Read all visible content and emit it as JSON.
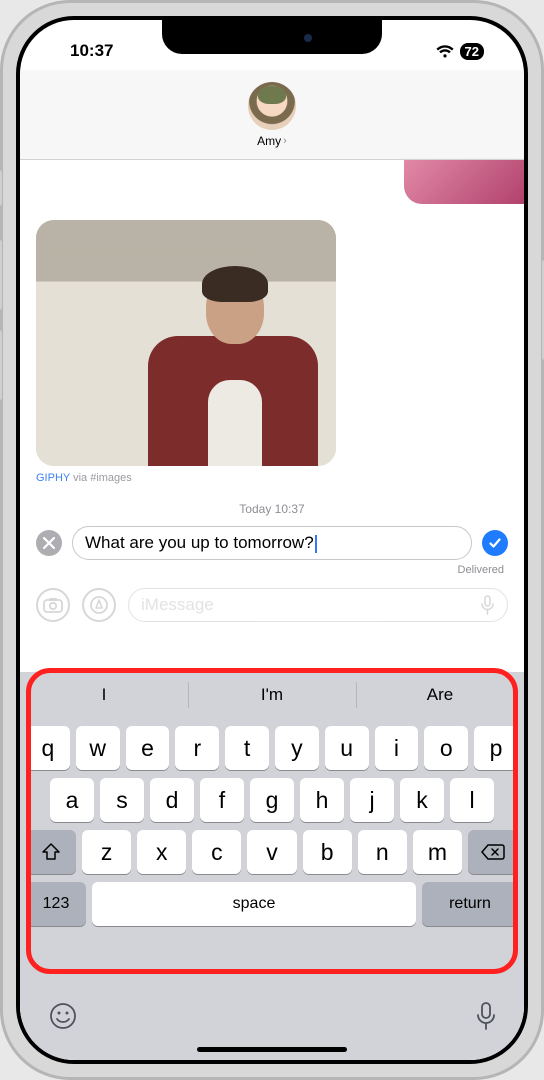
{
  "status": {
    "time": "10:37",
    "battery": "72"
  },
  "contact": {
    "name": "Amy"
  },
  "gif": {
    "source": "GIPHY",
    "via": " via #images"
  },
  "timestamp": "Today 10:37",
  "edit": {
    "text": "What are you up to tomorrow?"
  },
  "delivered": "Delivered",
  "compose": {
    "placeholder": "iMessage"
  },
  "suggestions": [
    "I",
    "I'm",
    "Are"
  ],
  "keys": {
    "row1": [
      "q",
      "w",
      "e",
      "r",
      "t",
      "y",
      "u",
      "i",
      "o",
      "p"
    ],
    "row2": [
      "a",
      "s",
      "d",
      "f",
      "g",
      "h",
      "j",
      "k",
      "l"
    ],
    "row3": [
      "z",
      "x",
      "c",
      "v",
      "b",
      "n",
      "m"
    ],
    "numbers": "123",
    "space": "space",
    "return": "return"
  }
}
